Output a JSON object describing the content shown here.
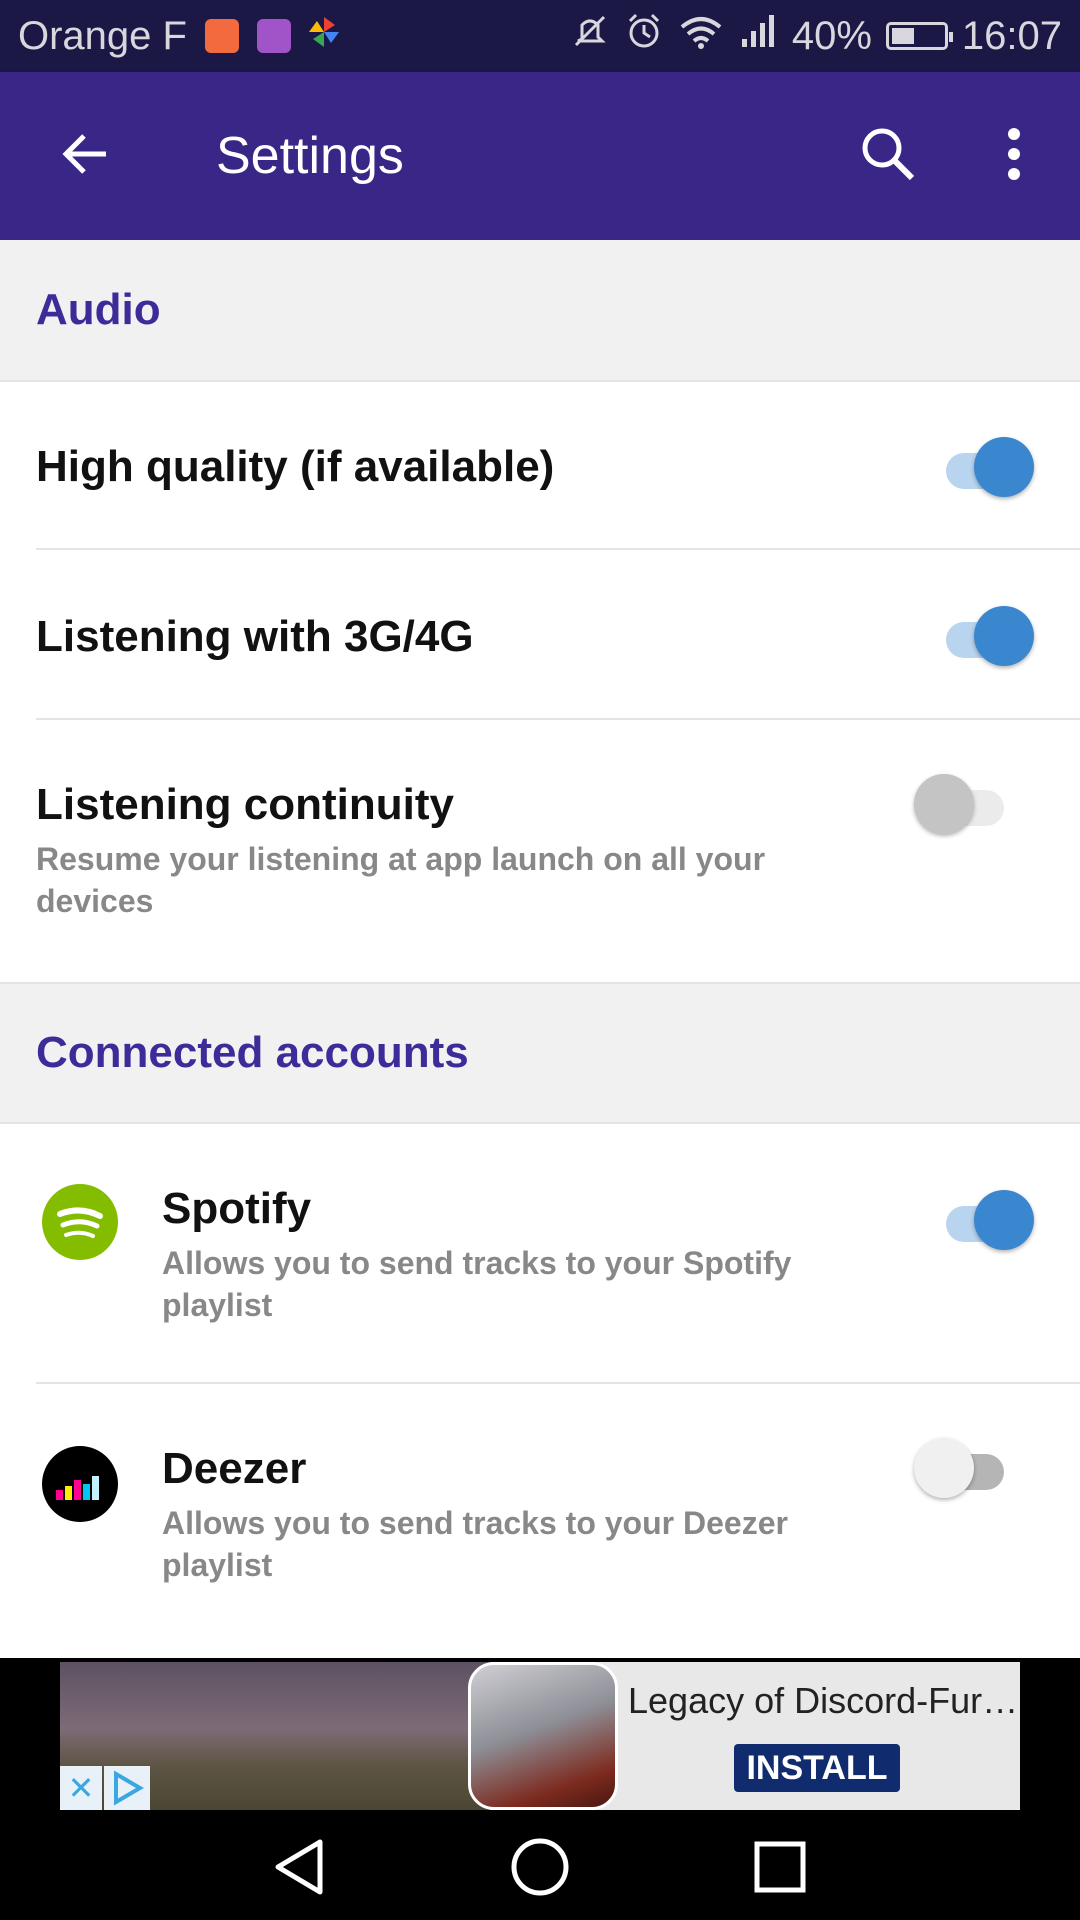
{
  "status_bar": {
    "carrier": "Orange F",
    "battery_percent": "40%",
    "time": "16:07",
    "icons": [
      "health-app-icon",
      "gallery-app-icon",
      "pinwheel-app-icon",
      "mute-icon",
      "alarm-icon",
      "wifi-icon",
      "signal-icon",
      "battery-icon"
    ]
  },
  "app_bar": {
    "title": "Settings",
    "icons": [
      "back-arrow-icon",
      "search-icon",
      "more-vert-icon"
    ]
  },
  "sections": {
    "audio": {
      "title": "Audio",
      "items": [
        {
          "title": "High quality (if available)",
          "enabled": true
        },
        {
          "title": "Listening with 3G/4G",
          "enabled": true
        },
        {
          "title": "Listening continuity",
          "subtitle": "Resume your listening at app launch on all your devices",
          "enabled": false
        }
      ]
    },
    "connected": {
      "title": "Connected accounts",
      "items": [
        {
          "title": "Spotify",
          "subtitle": "Allows you to send tracks to your Spotify playlist",
          "enabled": true,
          "icon": "spotify-icon"
        },
        {
          "title": "Deezer",
          "subtitle": "Allows you to send tracks to your Deezer playlist",
          "enabled": false,
          "icon": "deezer-icon"
        }
      ]
    }
  },
  "ad": {
    "title": "Legacy of Discord-Fur…",
    "install_label": "INSTALL",
    "close_glyph": "✕"
  },
  "colors": {
    "status_bar": "#1c1846",
    "app_bar": "#392687",
    "section_title": "#3d2b9a",
    "toggle_on": "#3a87cf",
    "spotify": "#84bd00"
  }
}
